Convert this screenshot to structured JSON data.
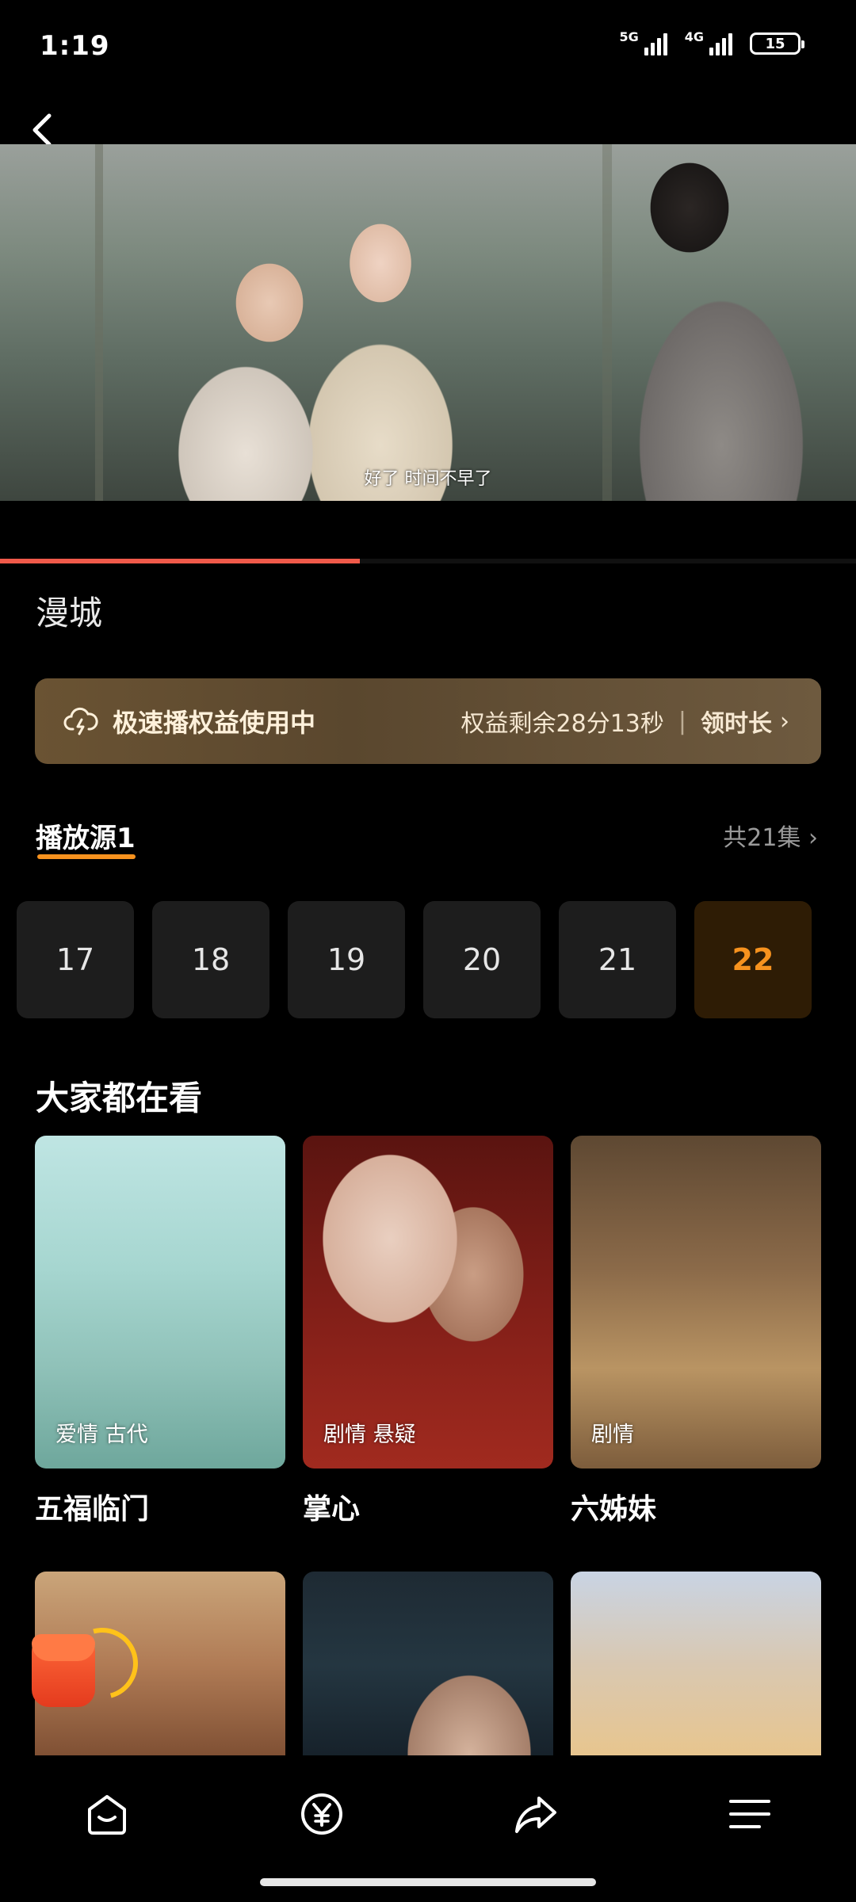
{
  "status_bar": {
    "time": "1:19",
    "network1": "5G",
    "network2": "4G",
    "battery": "15"
  },
  "video": {
    "subtitle": "好了 时间不早了",
    "progress_fraction": 0.42
  },
  "show": {
    "title": "漫城"
  },
  "banner": {
    "label": "极速播权益使用中",
    "remaining": "权益剩余28分13秒",
    "claim": "领时长"
  },
  "source": {
    "tab_label": "播放源1",
    "total_label": "共21集"
  },
  "episodes": [
    "17",
    "18",
    "19",
    "20",
    "21",
    "22"
  ],
  "active_episode": "22",
  "recommend": {
    "title": "大家都在看",
    "row1": [
      {
        "tags": "爱情 古代",
        "name": "五福临门"
      },
      {
        "tags": "剧情 悬疑",
        "name": "掌心"
      },
      {
        "tags": "剧情",
        "name": "六姊妹"
      }
    ]
  },
  "colors": {
    "accent_orange": "#f7921e",
    "progress_red": "#f05a4a",
    "banner_gold": "#6a5333"
  },
  "bottom_nav": [
    "home-icon",
    "yuan-coin-icon",
    "share-icon",
    "menu-icon"
  ]
}
